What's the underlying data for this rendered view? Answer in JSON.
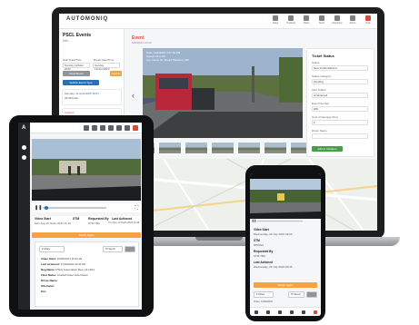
{
  "colors": {
    "accent_red": "#e84a3a",
    "accent_orange": "#f4a340",
    "accent_blue": "#2b6fb3",
    "device_black": "#0f1012"
  },
  "laptop": {
    "brand": "AUTOMONIQ",
    "nav_labels": [
      "Video",
      "Tracking",
      "Maps",
      "Alerts",
      "Reporting",
      "Admin",
      "Help"
    ],
    "sidebar": {
      "title": "PSCL Events",
      "subtitle": "Info",
      "start_label": "Start Date/Time",
      "end_label": "Break Date/Time",
      "start_value": "Sunday 12/Mar/ 2022",
      "end_value": "Sunday 13/Jun/2022",
      "clear_button": "Clear/Reset",
      "go_button": "Search",
      "filter_button": "Vehicle Event Type",
      "events": [
        {
          "title": "Monday, 14 April 2025 18:47",
          "detail": "23:49 km/h"
        },
        {
          "title": "Incident",
          "detail": "Wednesday 17 June 2025 22:24"
        },
        {
          "title": "Lane Violation",
          "detail": "22:41:04 km/h"
        }
      ]
    },
    "main": {
      "title": "Event",
      "subtitle": "MAN0017 04:42",
      "overlay": "Date: 11/2/2020 4:37:39 PM\nSpeed: 21 km/h\nLoc: Kemp St, Mount Pleasant, 4W"
    },
    "panel": {
      "title": "Ticket Status",
      "fields": [
        {
          "label": "Status",
          "value": "New Incident/Event"
        },
        {
          "label": "Status Category",
          "value": "Pending"
        },
        {
          "label": "Alert Status",
          "value": "Unactioned"
        },
        {
          "label": "Event Number",
          "value": "000"
        },
        {
          "label": "Cost of Damage Price",
          "value": "0"
        },
        {
          "label": "Driver Name",
          "value": ""
        }
      ],
      "save_button": "Add to Violation"
    }
  },
  "tablet": {
    "info": {
      "video_start_label": "Video Start",
      "video_start_value": "Mon Aug 15 North 2023 11:43",
      "stm_label": "STM",
      "requested_label": "Requested By",
      "requested_value": "STM TBA",
      "last_actioned_label": "Last Actioned",
      "last_actioned_value": "Thu Nov 14 North 2024 13:49"
    },
    "orange_button": "Watch Again",
    "actions": {
      "more": "More",
      "send": "Send"
    },
    "details": [
      {
        "label": "Video Start:",
        "value": "16/05/2024 13:31:29"
      },
      {
        "label": "Last Actioned:",
        "value": "17/04/2024 20:11:08"
      },
      {
        "label": "Reg Name:",
        "value": "PSCL Automation Res Ltd 1234"
      },
      {
        "label": "Fleet Name:",
        "value": "Chettah Fleet Vide Fleets"
      },
      {
        "label": "Driver Name:",
        "value": ""
      },
      {
        "label": "Odometer:",
        "value": ""
      },
      {
        "label": "Km:",
        "value": ""
      }
    ]
  },
  "phone": {
    "video_start_label": "Video Start",
    "video_start_value": "Wednesday, 29 July 2020 09:29",
    "stm_label": "STM",
    "stm_value": "5P09G6",
    "requested_label": "Requested By",
    "requested_value": "STM TBA",
    "last_actioned_label": "Last Actioned",
    "last_actioned_value": "Wednesday, 29 July 2020 09:45",
    "orange_button": "Watch Again",
    "actions": {
      "more": "More",
      "send": "Send"
    },
    "footer_label": "Video: 12/06/2020"
  }
}
